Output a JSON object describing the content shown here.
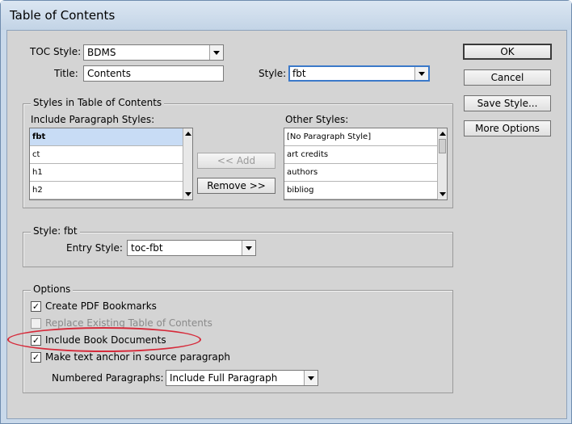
{
  "window": {
    "title": "Table of Contents"
  },
  "toc_style": {
    "label": "TOC Style:",
    "value": "BDMS"
  },
  "title_field": {
    "label": "Title:",
    "value": "Contents"
  },
  "style_field": {
    "label": "Style:",
    "value": "fbt"
  },
  "styles_group": {
    "legend": "Styles in Table of Contents",
    "include_label": "Include Paragraph Styles:",
    "include_items": [
      "fbt",
      "ct",
      "h1",
      "h2"
    ],
    "other_label": "Other Styles:",
    "other_items": [
      "[No Paragraph Style]",
      "art credits",
      "authors",
      "bibliog"
    ],
    "add_label": "<< Add",
    "remove_label": "Remove >>"
  },
  "style_group": {
    "legend": "Style: fbt",
    "entry_label": "Entry Style:",
    "entry_value": "toc-fbt"
  },
  "options_group": {
    "legend": "Options",
    "create_bookmarks": {
      "label": "Create PDF Bookmarks",
      "checked": true
    },
    "replace_existing": {
      "label": "Replace Existing Table of Contents",
      "checked": false,
      "enabled": false
    },
    "include_book": {
      "label": "Include Book Documents",
      "checked": true
    },
    "text_anchor": {
      "label": "Make text anchor in source paragraph",
      "checked": true
    },
    "numbered_label": "Numbered Paragraphs:",
    "numbered_value": "Include Full Paragraph"
  },
  "buttons": {
    "ok": "OK",
    "cancel": "Cancel",
    "save_style": "Save Style...",
    "more_options": "More Options"
  },
  "colors": {
    "highlight": "#d62a3a",
    "selection": "#c8dcf5",
    "title_bar": "#c9d9ea"
  }
}
